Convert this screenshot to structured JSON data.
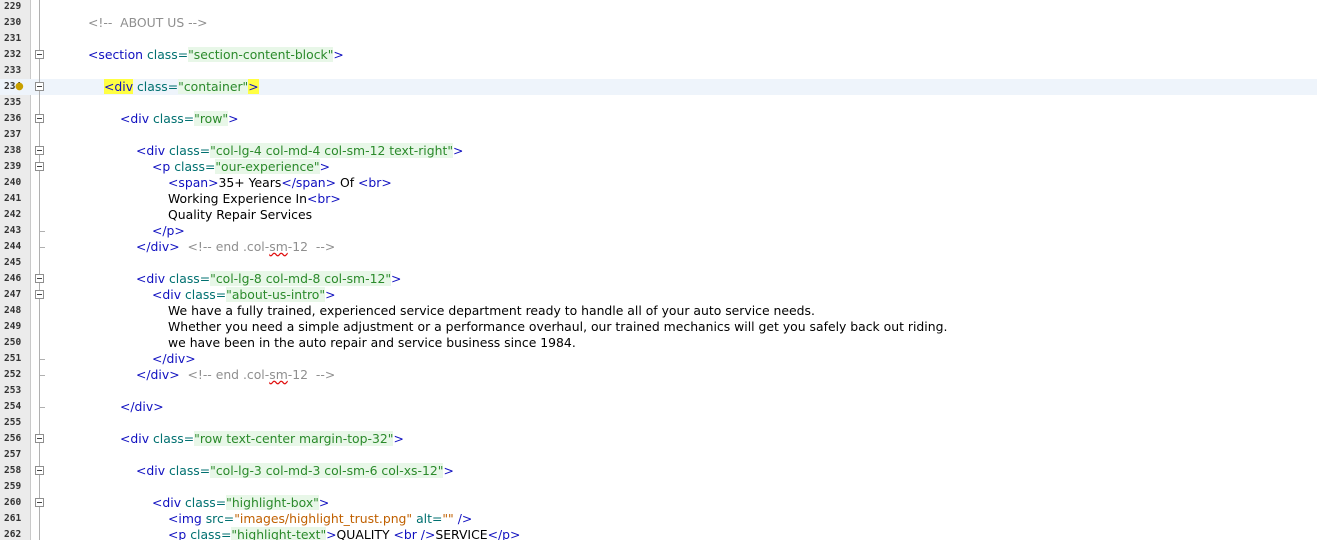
{
  "editor": {
    "lines": [
      {
        "n": "229"
      },
      {
        "n": "230",
        "indent": 0,
        "parts": [
          [
            "c",
            "<!--  ABOUT US -->"
          ]
        ]
      },
      {
        "n": "231"
      },
      {
        "n": "232",
        "fold": true,
        "indent": 0,
        "parts": [
          [
            "t",
            "<section "
          ],
          [
            "a",
            "class="
          ],
          [
            "v",
            "\"section-content-block\""
          ],
          [
            "t",
            ">"
          ]
        ]
      },
      {
        "n": "233"
      },
      {
        "n": "234",
        "fold": true,
        "current": true,
        "bulb": true,
        "indent": 1,
        "parts": [
          [
            "hl",
            "<div"
          ],
          [
            "t",
            " "
          ],
          [
            "a",
            "class="
          ],
          [
            "v",
            "\"container\""
          ],
          [
            "hl",
            ">"
          ]
        ]
      },
      {
        "n": "235"
      },
      {
        "n": "236",
        "fold": true,
        "indent": 2,
        "parts": [
          [
            "t",
            "<div "
          ],
          [
            "a",
            "class="
          ],
          [
            "v",
            "\"row\""
          ],
          [
            "t",
            ">"
          ]
        ]
      },
      {
        "n": "237"
      },
      {
        "n": "238",
        "fold": true,
        "indent": 3,
        "parts": [
          [
            "t",
            "<div "
          ],
          [
            "a",
            "class="
          ],
          [
            "v",
            "\"col-lg-4 col-md-4 col-sm-12 text-right\""
          ],
          [
            "t",
            ">"
          ]
        ]
      },
      {
        "n": "239",
        "fold": true,
        "indent": 4,
        "parts": [
          [
            "t",
            "<p "
          ],
          [
            "a",
            "class="
          ],
          [
            "v",
            "\"our-experience\""
          ],
          [
            "t",
            ">"
          ]
        ]
      },
      {
        "n": "240",
        "indent": 5,
        "parts": [
          [
            "t",
            "<span>"
          ],
          [
            "x",
            "35+ Years"
          ],
          [
            "t",
            "</span>"
          ],
          [
            "x",
            " Of "
          ],
          [
            "t",
            "<br>"
          ]
        ]
      },
      {
        "n": "241",
        "indent": 5,
        "parts": [
          [
            "x",
            "Working Experience In"
          ],
          [
            "t",
            "<br>"
          ]
        ]
      },
      {
        "n": "242",
        "indent": 5,
        "parts": [
          [
            "x",
            "Quality Repair Services"
          ]
        ]
      },
      {
        "n": "243",
        "end": true,
        "indent": 4,
        "parts": [
          [
            "t",
            "</p>"
          ]
        ]
      },
      {
        "n": "244",
        "end": true,
        "indent": 3,
        "parts": [
          [
            "t",
            "</div> "
          ],
          [
            "c",
            " <!-- end .col-"
          ],
          [
            "cw",
            "sm"
          ],
          [
            "c",
            "-12  -->"
          ]
        ]
      },
      {
        "n": "245"
      },
      {
        "n": "246",
        "fold": true,
        "indent": 3,
        "parts": [
          [
            "t",
            "<div "
          ],
          [
            "a",
            "class="
          ],
          [
            "v",
            "\"col-lg-8 col-md-8 col-sm-12\""
          ],
          [
            "t",
            ">"
          ]
        ]
      },
      {
        "n": "247",
        "fold": true,
        "indent": 4,
        "parts": [
          [
            "t",
            "<div "
          ],
          [
            "a",
            "class="
          ],
          [
            "v",
            "\"about-us-intro\""
          ],
          [
            "t",
            ">"
          ]
        ]
      },
      {
        "n": "248",
        "indent": 5,
        "parts": [
          [
            "x",
            "We have a fully trained, experienced service department ready to handle all of your auto service needs."
          ]
        ]
      },
      {
        "n": "249",
        "indent": 5,
        "parts": [
          [
            "x",
            "Whether you need a simple adjustment or a performance overhaul, our trained mechanics will get you safely back out riding."
          ]
        ]
      },
      {
        "n": "250",
        "indent": 5,
        "parts": [
          [
            "x",
            "we have been in the auto repair and service business since 1984."
          ]
        ]
      },
      {
        "n": "251",
        "end": true,
        "indent": 4,
        "parts": [
          [
            "t",
            "</div>"
          ]
        ]
      },
      {
        "n": "252",
        "end": true,
        "indent": 3,
        "parts": [
          [
            "t",
            "</div> "
          ],
          [
            "c",
            " <!-- end .col-"
          ],
          [
            "cw",
            "sm"
          ],
          [
            "c",
            "-12  -->"
          ]
        ]
      },
      {
        "n": "253"
      },
      {
        "n": "254",
        "end": true,
        "indent": 2,
        "parts": [
          [
            "t",
            "</div>"
          ]
        ]
      },
      {
        "n": "255"
      },
      {
        "n": "256",
        "fold": true,
        "indent": 2,
        "parts": [
          [
            "t",
            "<div "
          ],
          [
            "a",
            "class="
          ],
          [
            "v",
            "\"row text-center margin-top-32\""
          ],
          [
            "t",
            ">"
          ]
        ]
      },
      {
        "n": "257"
      },
      {
        "n": "258",
        "fold": true,
        "indent": 3,
        "parts": [
          [
            "t",
            "<div "
          ],
          [
            "a",
            "class="
          ],
          [
            "v",
            "\"col-lg-3 col-md-3 col-sm-6 col-xs-12\""
          ],
          [
            "t",
            ">"
          ]
        ]
      },
      {
        "n": "259"
      },
      {
        "n": "260",
        "fold": true,
        "indent": 4,
        "parts": [
          [
            "t",
            "<div "
          ],
          [
            "a",
            "class="
          ],
          [
            "v",
            "\"highlight-box\""
          ],
          [
            "t",
            ">"
          ]
        ]
      },
      {
        "n": "261",
        "indent": 5,
        "parts": [
          [
            "t",
            "<img "
          ],
          [
            "a",
            "src="
          ],
          [
            "v2",
            "\"images/highlight_trust.png\""
          ],
          [
            "a",
            " alt="
          ],
          [
            "v2",
            "\"\""
          ],
          [
            "t",
            " />"
          ]
        ]
      },
      {
        "n": "262",
        "indent": 5,
        "parts": [
          [
            "t",
            "<p "
          ],
          [
            "a",
            "class="
          ],
          [
            "v",
            "\"highlight-text\""
          ],
          [
            "t",
            ">"
          ],
          [
            "x",
            "QUALITY "
          ],
          [
            "t",
            "<br />"
          ],
          [
            "x",
            "SERVICE"
          ],
          [
            "t",
            "</p>"
          ]
        ]
      }
    ]
  }
}
